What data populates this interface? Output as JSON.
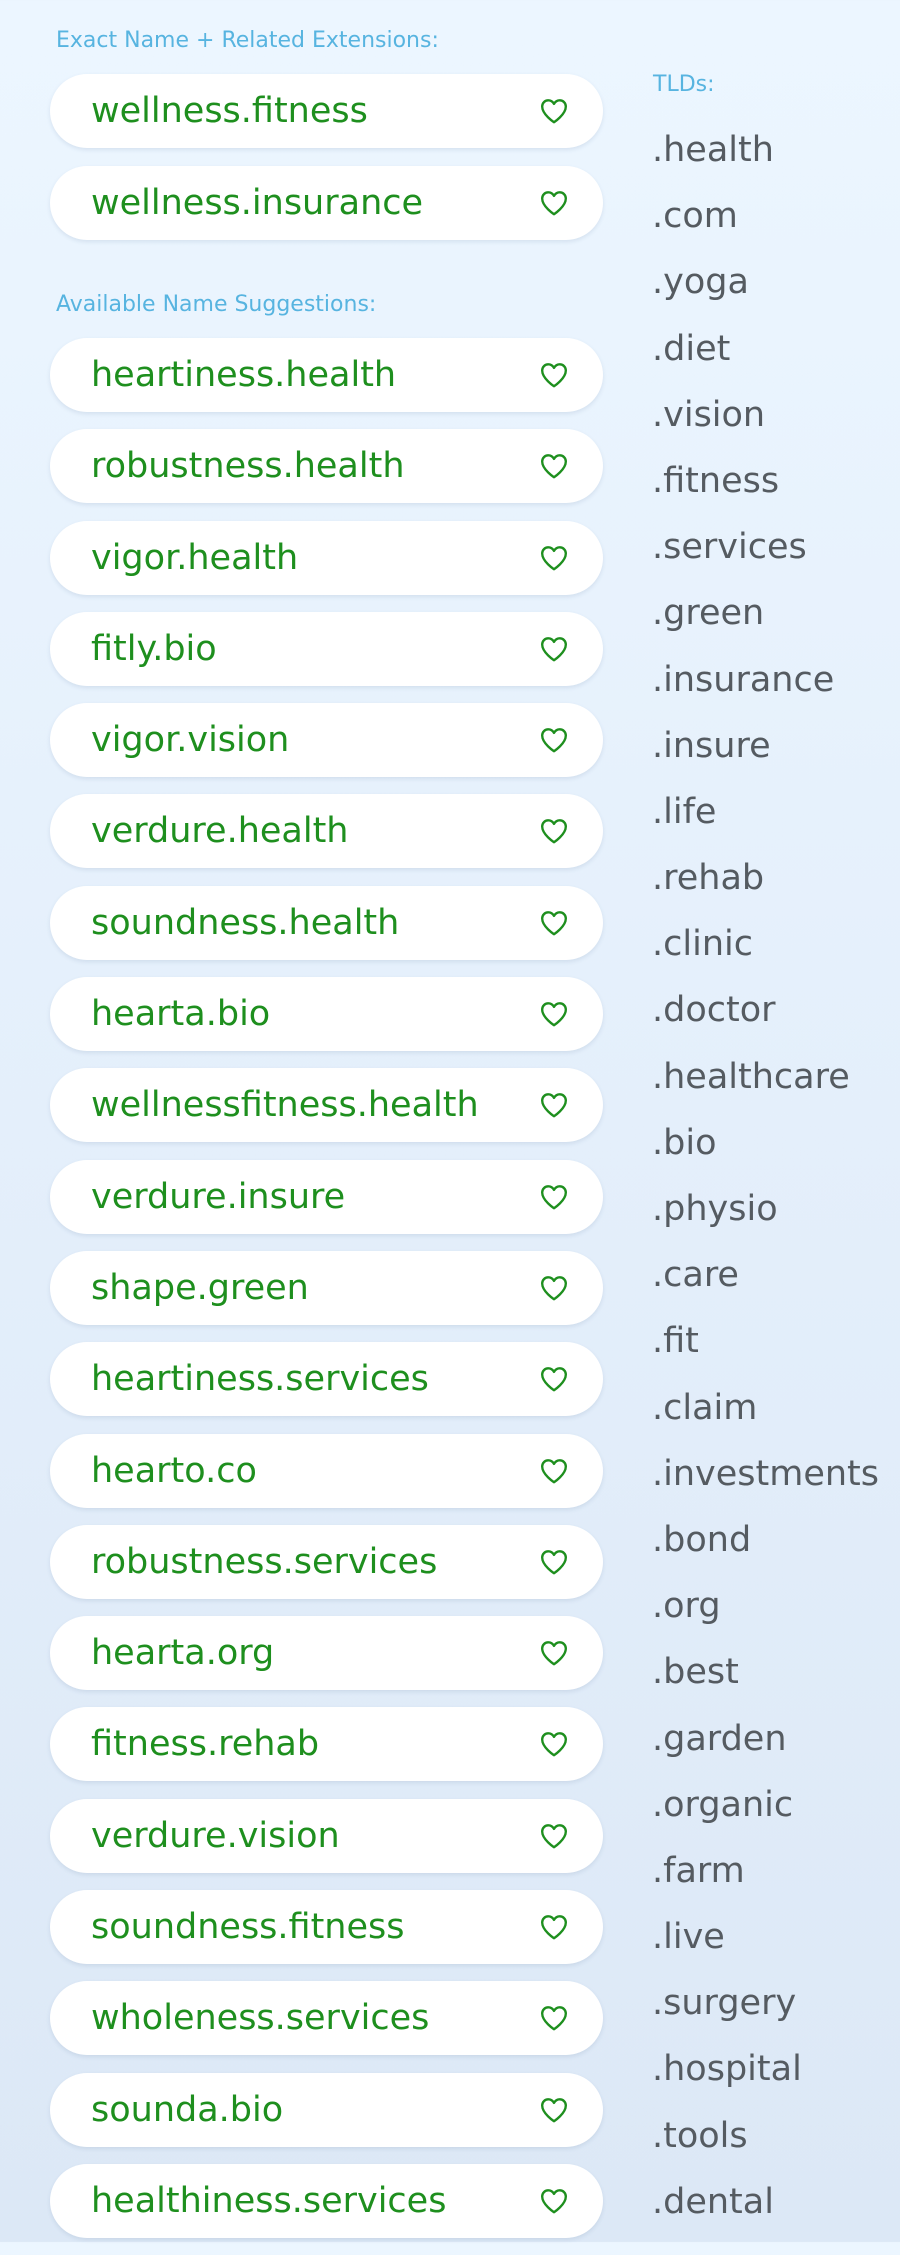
{
  "exact_section": {
    "heading": "Exact Name + Related Extensions:",
    "items": [
      "wellness.fitness",
      "wellness.insurance"
    ]
  },
  "suggestions_section": {
    "heading": "Available Name Suggestions:",
    "items": [
      "heartiness.health",
      "robustness.health",
      "vigor.health",
      "fitly.bio",
      "vigor.vision",
      "verdure.health",
      "soundness.health",
      "hearta.bio",
      "wellnessfitness.health",
      "verdure.insure",
      "shape.green",
      "heartiness.services",
      "hearto.co",
      "robustness.services",
      "hearta.org",
      "fitness.rehab",
      "verdure.vision",
      "soundness.fitness",
      "wholeness.services",
      "sounda.bio",
      "healthiness.services"
    ]
  },
  "tlds_section": {
    "heading": "TLDs:",
    "items": [
      ".health",
      ".com",
      ".yoga",
      ".diet",
      ".vision",
      ".fitness",
      ".services",
      ".green",
      ".insurance",
      ".insure",
      ".life",
      ".rehab",
      ".clinic",
      ".doctor",
      ".healthcare",
      ".bio",
      ".physio",
      ".care",
      ".fit",
      ".claim",
      ".investments",
      ".bond",
      ".org",
      ".best",
      ".garden",
      ".organic",
      ".farm",
      ".live",
      ".surgery",
      ".hospital",
      ".tools",
      ".dental"
    ]
  },
  "icons": {
    "favorite": "heart-outline-icon"
  },
  "colors": {
    "heading": "#57b4e0",
    "domain_text": "#1e8f1e",
    "heart_stroke": "#1e8f1e",
    "tld_text": "#555b61",
    "pill_background": "#ffffff"
  }
}
